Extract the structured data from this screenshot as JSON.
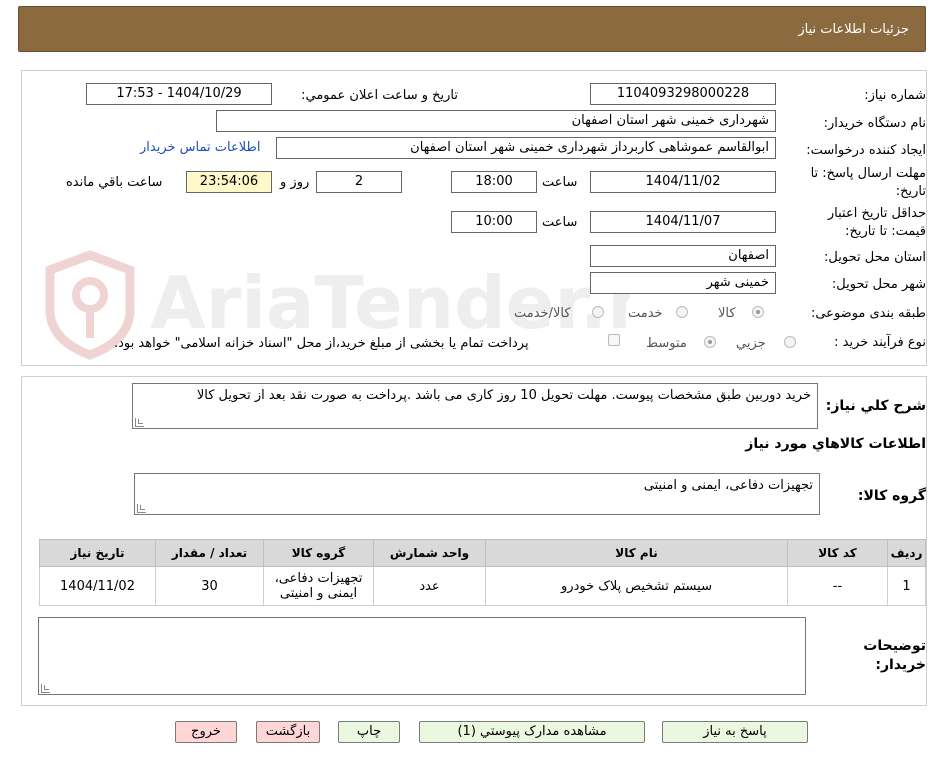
{
  "header": {
    "title": "جزئیات اطلاعات نیاز"
  },
  "fields": {
    "need_number_label": "شماره نیاز:",
    "need_number": "1104093298000228",
    "announce_label": "تاریخ و ساعت اعلان عمومي:",
    "announce_value": "1404/10/29 - 17:53",
    "buyer_label": "نام دستگاه خريدار:",
    "buyer_value": "شهرداری خمینی شهر استان اصفهان",
    "creator_label": "ايجاد کننده درخواست:",
    "creator_value": "ابوالقاسم عموشاهی کاربرداز شهرداری خمینی شهر استان اصفهان",
    "contact_link": "اطلاعات تماس خريدار",
    "deadline_label_1": "مهلت ارسال پاسخ: تا",
    "deadline_label_2": "تاريخ:",
    "deadline_date": "1404/11/02",
    "time_label": "ساعت",
    "deadline_time": "18:00",
    "days_value": "2",
    "days_label": "روز و",
    "remaining_value": "23:54:06",
    "remaining_label": "ساعت باقي مانده",
    "validity_label_1": "حداقل تاريخ اعتبار",
    "validity_label_2": "قيمت: تا تاريخ:",
    "validity_date": "1404/11/07",
    "validity_time": "10:00",
    "province_label": "استان محل تحويل:",
    "province_value": "اصفهان",
    "city_label": "شهر محل تحويل:",
    "city_value": "خمینی شهر",
    "category_label": "طبقه بندی موضوعی:",
    "category_goods": "کالا",
    "category_service": "خدمت",
    "category_both": "کالا/خدمت",
    "process_label": "نوع فرآيند خريد :",
    "process_minor": "جزيي",
    "process_medium": "متوسط",
    "payment_note": "پرداخت تمام يا بخشی از مبلغ خريد،از محل \"اسناد خزانه اسلامی\" خواهد بود."
  },
  "description": {
    "label": "شرح کلي نياز:",
    "text": "خرید دوربین طبق مشخصات پیوست. مهلت تحویل 10 روز کاری می باشد .پرداخت به صورت نقد بعد از تحویل کالا"
  },
  "goods": {
    "section_title": "اطلاعات کالاهاي مورد نياز",
    "group_label": "گروه کالا:",
    "group_value": "تجهیزات دفاعی، ایمنی و امنیتی",
    "columns": [
      "رديف",
      "کد کالا",
      "نام کالا",
      "واحد شمارش",
      "گروه کالا",
      "تعداد / مقدار",
      "تاريخ نياز"
    ],
    "rows": [
      [
        "1",
        "--",
        "سیستم تشخیص پلاک خودرو",
        "عدد",
        "تجهیزات دفاعی، ایمنی و امنیتی",
        "30",
        "1404/11/02"
      ]
    ]
  },
  "notes": {
    "label_1": "توضيحات",
    "label_2": "خريدار:",
    "value": ""
  },
  "buttons": {
    "reply": "پاسخ به نياز",
    "attachments": "مشاهده مدارک پيوستي (1)",
    "print": "چاپ",
    "back": "بازگشت",
    "exit": "خروج"
  },
  "watermark": {
    "text": "AriaTender.neT"
  },
  "colors": {
    "header": "#8c6a3f",
    "link": "#1e4fbf",
    "green_button": "#e9f8df",
    "pink_button": "#ffd6d6",
    "remaining_bg": "#fff8c8"
  }
}
